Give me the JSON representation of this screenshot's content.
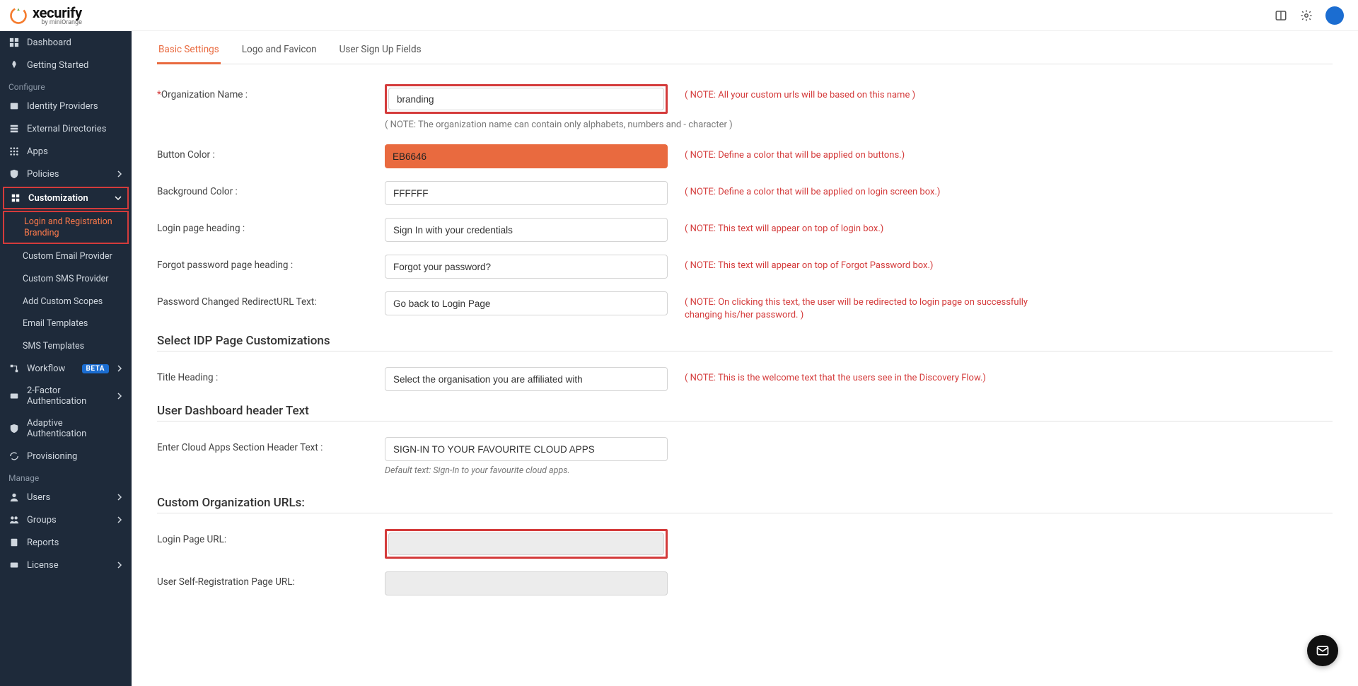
{
  "logo": {
    "text": "xecurify",
    "sub": "by miniOrange"
  },
  "sidebar": {
    "items": [
      {
        "label": "Dashboard",
        "icon": "dashboard"
      },
      {
        "label": "Getting Started",
        "icon": "rocket"
      }
    ],
    "section_configure": "Configure",
    "configure_items": [
      {
        "label": "Identity Providers",
        "icon": "idp"
      },
      {
        "label": "External Directories",
        "icon": "dir"
      },
      {
        "label": "Apps",
        "icon": "apps"
      },
      {
        "label": "Policies",
        "icon": "shield",
        "caret": true
      },
      {
        "label": "Customization",
        "icon": "puzzle",
        "expanded": true,
        "active": true
      }
    ],
    "customization_sub": [
      {
        "label": "Login and Registration Branding",
        "active": true
      },
      {
        "label": "Custom Email Provider"
      },
      {
        "label": "Custom SMS Provider"
      },
      {
        "label": "Add Custom Scopes"
      },
      {
        "label": "Email Templates"
      },
      {
        "label": "SMS Templates"
      }
    ],
    "after_customization": [
      {
        "label": "Workflow",
        "icon": "flow",
        "badge": "BETA",
        "caret": true
      },
      {
        "label": "2-Factor Authentication",
        "icon": "twofa",
        "caret": true
      },
      {
        "label": "Adaptive Authentication",
        "icon": "shield2"
      },
      {
        "label": "Provisioning",
        "icon": "refresh"
      }
    ],
    "section_manage": "Manage",
    "manage_items": [
      {
        "label": "Users",
        "icon": "user",
        "caret": true
      },
      {
        "label": "Groups",
        "icon": "group",
        "caret": true
      },
      {
        "label": "Reports",
        "icon": "clipboard"
      },
      {
        "label": "License",
        "icon": "card",
        "caret": true
      }
    ]
  },
  "tabs": [
    {
      "label": "Basic Settings",
      "active": true
    },
    {
      "label": "Logo and Favicon"
    },
    {
      "label": "User Sign Up Fields"
    }
  ],
  "form": {
    "org_name": {
      "label": "Organization Name :",
      "value": "branding",
      "note": "( NOTE: All your custom urls will be based on this name )",
      "subnote": "( NOTE: The organization name can contain only alphabets, numbers and - character )"
    },
    "button_color": {
      "label": "Button Color :",
      "value": "EB6646",
      "note": "( NOTE: Define a color that will be applied on buttons.)"
    },
    "bg_color": {
      "label": "Background Color :",
      "value": "FFFFFF",
      "note": "( NOTE: Define a color that will be applied on login screen box.)"
    },
    "login_heading": {
      "label": "Login page heading :",
      "value": "Sign In with your credentials",
      "note": "( NOTE: This text will appear on top of login box.)"
    },
    "forgot_heading": {
      "label": "Forgot password page heading :",
      "value": "Forgot your password?",
      "note": "( NOTE: This text will appear on top of Forgot Password box.)"
    },
    "pw_redirect": {
      "label": "Password Changed RedirectURL Text:",
      "value": "Go back to Login Page",
      "note": "( NOTE: On clicking this text, the user will be redirected to login page on successfully changing his/her password. )"
    },
    "section_idp": "Select IDP Page Customizations",
    "title_heading": {
      "label": "Title Heading :",
      "value": "Select the organisation you are affiliated with",
      "note": "( NOTE: This is the welcome text that the users see in the Discovery Flow.)"
    },
    "section_dash": "User Dashboard header Text",
    "cloud_header": {
      "label": "Enter Cloud Apps Section Header Text :",
      "value": "SIGN-IN TO YOUR FAVOURITE CLOUD APPS",
      "subnote": "Default text: Sign-In to your favourite cloud apps."
    },
    "section_urls": "Custom Organization URLs:",
    "login_url": {
      "label": "Login Page URL:",
      "value": ""
    },
    "selfreg_url": {
      "label": "User Self-Registration Page URL:",
      "value": ""
    }
  }
}
